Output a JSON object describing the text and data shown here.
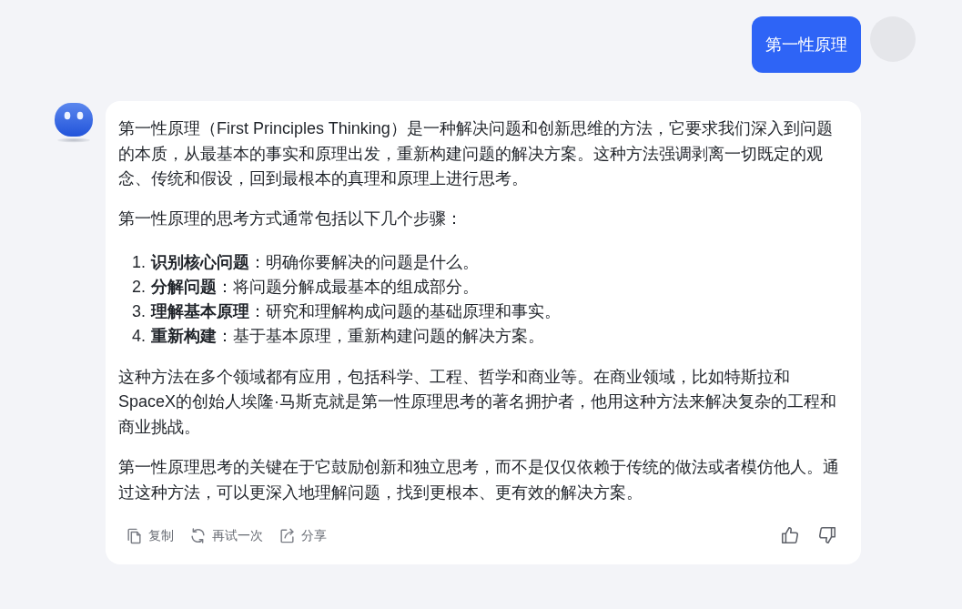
{
  "messages": [
    {
      "kind": "user",
      "text": "第一性原理"
    },
    {
      "kind": "assistant",
      "blocks": [
        {
          "kind": "paragraph",
          "text": "第一性原理（First Principles Thinking）是一种解决问题和创新思维的方法，它要求我们深入到问题的本质，从最基本的事实和原理出发，重新构建问题的解决方案。这种方法强调剥离一切既定的观念、传统和假设，回到最根本的真理和原理上进行思考。"
        },
        {
          "kind": "paragraph",
          "text": "第一性原理的思考方式通常包括以下几个步骤："
        },
        {
          "kind": "ordered_list",
          "items": [
            {
              "number": "1.",
              "text": "**识别核心问题**：明确你要解决的问题是什么。"
            },
            {
              "number": "2.",
              "text": "**分解问题**：将问题分解成最基本的组成部分。"
            },
            {
              "number": "3.",
              "text": "**理解基本原理**：研究和理解构成问题的基础原理和事实。"
            },
            {
              "number": "4.",
              "text": "**重新构建**：基于基本原理，重新构建问题的解决方案。"
            }
          ]
        },
        {
          "kind": "paragraph",
          "text": "这种方法在多个领域都有应用，包括科学、工程、哲学和商业等。在商业领域，比如特斯拉和SpaceX的创始人埃隆·马斯克就是第一性原理思考的著名拥护者，他用这种方法来解决复杂的工程和商业挑战。"
        },
        {
          "kind": "paragraph",
          "text": "第一性原理思考的关键在于它鼓励创新和独立思考，而不是仅仅依赖于传统的做法或者模仿他人。通过这种方法，可以更深入地理解问题，找到更根本、更有效的解决方案。"
        }
      ],
      "actions": [
        {
          "kind": "copy",
          "label": "复制"
        },
        {
          "kind": "retry",
          "label": "再试一次"
        },
        {
          "kind": "share",
          "label": "分享"
        }
      ]
    }
  ]
}
